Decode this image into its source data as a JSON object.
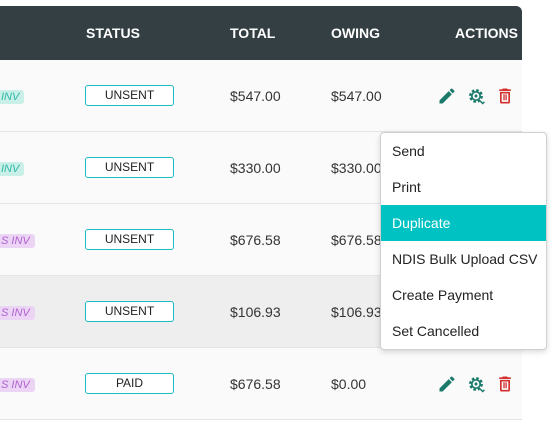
{
  "header": {
    "status": "STATUS",
    "total": "TOTAL",
    "owing": "OWING",
    "actions": "ACTIONS"
  },
  "rows": [
    {
      "tag": "INV",
      "tag_color": "teal",
      "status": "UNSENT",
      "total": "$547.00",
      "owing": "$547.00"
    },
    {
      "tag": "INV",
      "tag_color": "teal",
      "status": "UNSENT",
      "total": "$330.00",
      "owing": "$330.00"
    },
    {
      "tag": "S INV",
      "tag_color": "purple",
      "status": "UNSENT",
      "total": "$676.58",
      "owing": "$676.58"
    },
    {
      "tag": "S INV",
      "tag_color": "purple",
      "status": "UNSENT",
      "total": "$106.93",
      "owing": "$106.93"
    },
    {
      "tag": "S INV",
      "tag_color": "purple",
      "status": "PAID",
      "total": "$676.58",
      "owing": "$0.00"
    }
  ],
  "menu": {
    "items": [
      "Send",
      "Print",
      "Duplicate",
      "NDIS Bulk Upload CSV",
      "Create Payment",
      "Set Cancelled"
    ],
    "active": "Duplicate"
  },
  "colors": {
    "header_bg": "#343f44",
    "accent": "#00c2c2",
    "edit_icon": "#1a7a6a",
    "delete_icon": "#d32f2f"
  },
  "icons": [
    "pencil-icon",
    "gear-icon",
    "trash-icon"
  ]
}
